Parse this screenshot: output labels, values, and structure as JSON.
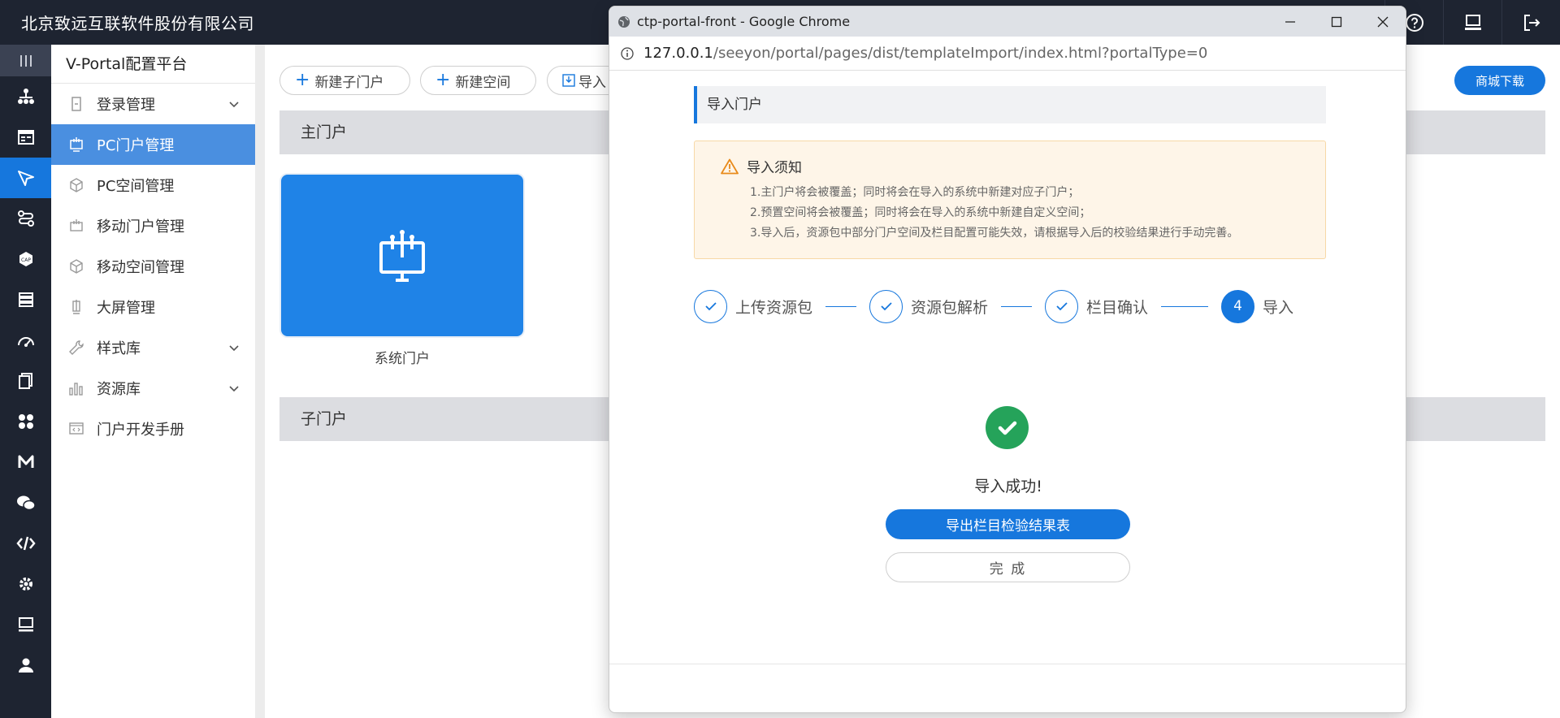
{
  "topbar": {
    "company": "北京致远互联软件股份有限公司",
    "icons": [
      "help-icon",
      "monitor-icon",
      "logout-icon"
    ]
  },
  "rail": {
    "items": [
      "menu-lines-icon",
      "org-tree-icon",
      "form-icon",
      "send-icon",
      "flow-icon",
      "cap-icon",
      "layers-icon",
      "gauge-icon",
      "document-icon",
      "apps-icon",
      "m-icon",
      "wechat-icon",
      "code-icon",
      "settings-icon",
      "screen-icon",
      "user-icon"
    ]
  },
  "menu": {
    "title": "V-Portal配置平台",
    "items": [
      {
        "label": "登录管理",
        "expandable": true
      },
      {
        "label": "PC门户管理",
        "active": true
      },
      {
        "label": "PC空间管理"
      },
      {
        "label": "移动门户管理"
      },
      {
        "label": "移动空间管理"
      },
      {
        "label": "大屏管理"
      },
      {
        "label": "样式库",
        "expandable": true
      },
      {
        "label": "资源库",
        "expandable": true
      },
      {
        "label": "门户开发手册"
      }
    ]
  },
  "main": {
    "buttons": {
      "new_sub_portal": "新建子门户",
      "new_space": "新建空间",
      "import": "导入"
    },
    "store_download": "商城下载",
    "section_main": "主门户",
    "section_sub": "子门户",
    "portal_card_name": "系统门户"
  },
  "popup": {
    "window_title": "ctp-portal-front - Google Chrome",
    "url_host": "127.0.0.1",
    "url_path": "/seeyon/portal/pages/dist/templateImport/index.html?portalType=0",
    "page_title": "导入门户",
    "notice": {
      "title": "导入须知",
      "lines": [
        "1.主门户将会被覆盖；同时将会在导入的系统中新建对应子门户；",
        "2.预置空间将会被覆盖；同时将会在导入的系统中新建自定义空间；",
        "3.导入后，资源包中部分门户空间及栏目配置可能失效，请根据导入后的校验结果进行手动完善。"
      ]
    },
    "steps": [
      {
        "label": "上传资源包",
        "done": true
      },
      {
        "label": "资源包解析",
        "done": true
      },
      {
        "label": "栏目确认",
        "done": true
      },
      {
        "label": "导入",
        "number": "4"
      }
    ],
    "success_text": "导入成功!",
    "export_button": "导出栏目检验结果表",
    "finish_button": "完 成"
  },
  "colors": {
    "accent": "#1677dd",
    "success": "#25a35a",
    "topbar": "#1e2431",
    "notice_bg": "#fef5e8"
  }
}
